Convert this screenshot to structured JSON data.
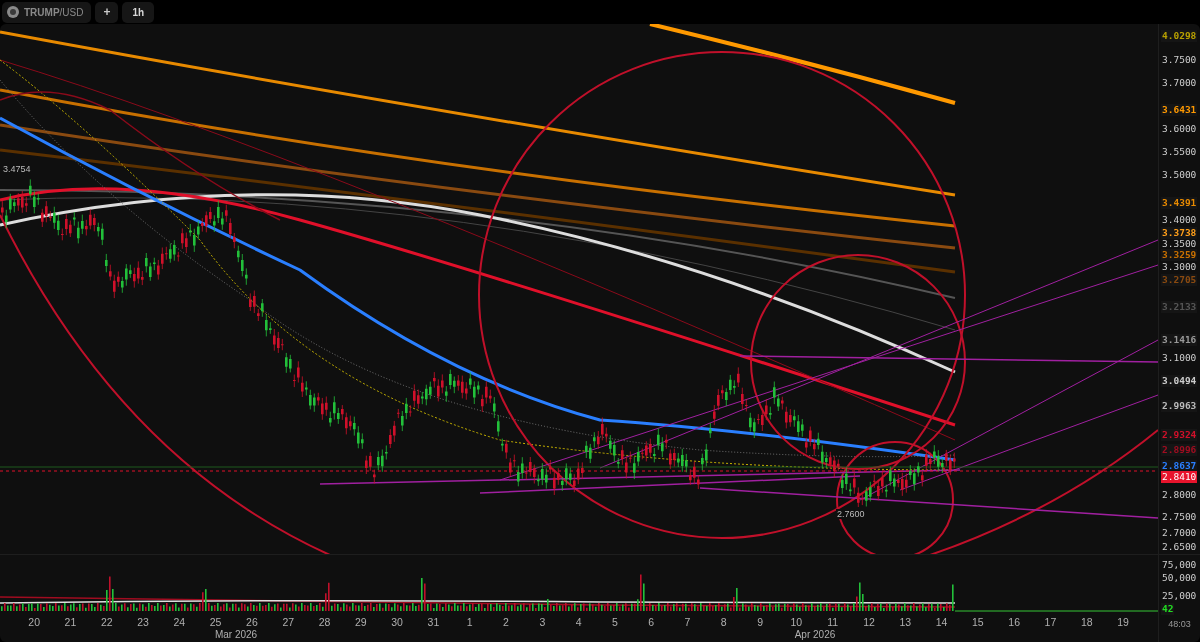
{
  "symbol": {
    "label": "**TRUMP**/USD"
  },
  "toolbar": [
    {
      "kind": "add",
      "label": "+"
    },
    {
      "kind": "interval",
      "label": "1h"
    }
  ],
  "price_axis": [
    {
      "label": "4.0298",
      "kind": "tag",
      "color": "#b8a000"
    },
    {
      "label": "3.7500",
      "kind": "tick"
    },
    {
      "label": "3.7000",
      "kind": "tick"
    },
    {
      "label": "3.6431",
      "kind": "tag",
      "color": "#ff9900"
    },
    {
      "label": "3.6000",
      "kind": "tick"
    },
    {
      "label": "3.5500",
      "kind": "tick"
    },
    {
      "label": "3.5000",
      "kind": "tick"
    },
    {
      "label": "3.4391",
      "kind": "tag",
      "color": "#e88a00"
    },
    {
      "label": "3.4000",
      "kind": "tick"
    },
    {
      "label": "3.3738",
      "kind": "tag",
      "color": "#ff9f1a"
    },
    {
      "label": "3.3500",
      "kind": "tick"
    },
    {
      "label": "3.3259",
      "kind": "tag",
      "color": "#c87000"
    },
    {
      "label": "3.3000",
      "kind": "tick"
    },
    {
      "label": "3.2705",
      "kind": "tag",
      "color": "#8a4a10"
    },
    {
      "label": "3.2133",
      "kind": "tag",
      "color": "#555555"
    },
    {
      "label": "3.1416",
      "kind": "tag",
      "color": "#999999"
    },
    {
      "label": "3.1000",
      "kind": "tick"
    },
    {
      "label": "3.0494",
      "kind": "tag",
      "color": "#cccccc"
    },
    {
      "label": "2.9963",
      "kind": "tag",
      "color": "#bbbbbb"
    },
    {
      "label": "2.9324",
      "kind": "tag",
      "color": "#d0102a"
    },
    {
      "label": "2.8996",
      "kind": "tag",
      "color": "#a00c20"
    },
    {
      "label": "2.8637",
      "kind": "tag",
      "color": "#2a7fff"
    },
    {
      "label": "2.8410",
      "kind": "current",
      "color": "#e8142c"
    },
    {
      "label": "2.8000",
      "kind": "tick"
    },
    {
      "label": "2.7500",
      "kind": "tick"
    },
    {
      "label": "2.7000",
      "kind": "tick"
    },
    {
      "label": "2.6500",
      "kind": "tick"
    }
  ],
  "chart_labels": [
    {
      "label": "3.4754"
    },
    {
      "label": "2.7600"
    }
  ],
  "volume_axis": [
    {
      "label": "75,000",
      "kind": "tick"
    },
    {
      "label": "50,000",
      "kind": "tick"
    },
    {
      "label": "25,000",
      "kind": "tick"
    },
    {
      "label": "42",
      "kind": "tag",
      "color": "#22dd22"
    }
  ],
  "time_axis": {
    "days": [
      "20",
      "21",
      "22",
      "23",
      "24",
      "25",
      "26",
      "27",
      "28",
      "29",
      "30",
      "31",
      "1",
      "2",
      "3",
      "4",
      "5",
      "6",
      "7",
      "8",
      "9",
      "10",
      "11",
      "12",
      "13",
      "14",
      "15",
      "16",
      "17",
      "18",
      "19"
    ],
    "months": [
      "Mar 2026",
      "Apr 2026"
    ],
    "countdown": "48:03"
  }
}
